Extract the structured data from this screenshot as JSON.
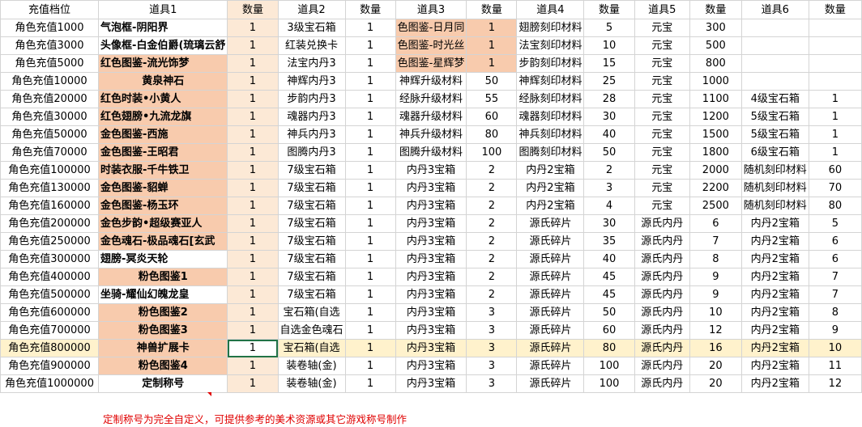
{
  "headers": [
    "充值档位",
    "道具1",
    "数量",
    "道具2",
    "数量",
    "道具3",
    "数量",
    "道具4",
    "数量",
    "道具5",
    "数量",
    "道具6",
    "数量"
  ],
  "rows": [
    [
      "角色充值1000",
      "气泡框-阴阳界",
      "1",
      "3级宝石箱",
      "1",
      "色图鉴-日月同",
      "1",
      "翅膀刻印材料",
      "5",
      "元宝",
      "300",
      "",
      ""
    ],
    [
      "角色充值3000",
      "头像框-白金伯爵(琉璃云舒",
      "1",
      "红装兑换卡",
      "1",
      "色图鉴-时光丝",
      "1",
      "法宝刻印材料",
      "10",
      "元宝",
      "500",
      "",
      ""
    ],
    [
      "角色充值5000",
      "红色图鉴-流光饰梦",
      "1",
      "法宝内丹3",
      "1",
      "色图鉴-星辉梦",
      "1",
      "步韵刻印材料",
      "15",
      "元宝",
      "800",
      "",
      ""
    ],
    [
      "角色充值10000",
      "黄泉神石",
      "1",
      "神辉内丹3",
      "1",
      "神辉升级材料",
      "50",
      "神辉刻印材料",
      "25",
      "元宝",
      "1000",
      "",
      ""
    ],
    [
      "角色充值20000",
      "红色时装•小黄人",
      "1",
      "步韵内丹3",
      "1",
      "经脉升级材料",
      "55",
      "经脉刻印材料",
      "28",
      "元宝",
      "1100",
      "4级宝石箱",
      "1"
    ],
    [
      "角色充值30000",
      "红色翅膀•九流龙旗",
      "1",
      "魂器内丹3",
      "1",
      "魂器升级材料",
      "60",
      "魂器刻印材料",
      "30",
      "元宝",
      "1200",
      "5级宝石箱",
      "1"
    ],
    [
      "角色充值50000",
      "金色图鉴-西施",
      "1",
      "神兵内丹3",
      "1",
      "神兵升级材料",
      "80",
      "神兵刻印材料",
      "40",
      "元宝",
      "1500",
      "5级宝石箱",
      "1"
    ],
    [
      "角色充值70000",
      "金色图鉴-王昭君",
      "1",
      "图腾内丹3",
      "1",
      "图腾升级材料",
      "100",
      "图腾刻印材料",
      "50",
      "元宝",
      "1800",
      "6级宝石箱",
      "1"
    ],
    [
      "角色充值100000",
      "时装衣服-千牛铁卫",
      "1",
      "7级宝石箱",
      "1",
      "内丹3宝箱",
      "2",
      "内丹2宝箱",
      "2",
      "元宝",
      "2000",
      "随机刻印材料",
      "60"
    ],
    [
      "角色充值130000",
      "金色图鉴-貂蝉",
      "1",
      "7级宝石箱",
      "1",
      "内丹3宝箱",
      "2",
      "内丹2宝箱",
      "3",
      "元宝",
      "2200",
      "随机刻印材料",
      "70"
    ],
    [
      "角色充值160000",
      "金色图鉴-杨玉环",
      "1",
      "7级宝石箱",
      "1",
      "内丹3宝箱",
      "2",
      "内丹2宝箱",
      "4",
      "元宝",
      "2500",
      "随机刻印材料",
      "80"
    ],
    [
      "角色充值200000",
      "金色步韵•超级赛亚人",
      "1",
      "7级宝石箱",
      "1",
      "内丹3宝箱",
      "2",
      "源氏碎片",
      "30",
      "源氏内丹",
      "6",
      "内丹2宝箱",
      "5"
    ],
    [
      "角色充值250000",
      "金色魂石-极品魂石[玄武",
      "1",
      "7级宝石箱",
      "1",
      "内丹3宝箱",
      "2",
      "源氏碎片",
      "35",
      "源氏内丹",
      "7",
      "内丹2宝箱",
      "6"
    ],
    [
      "角色充值300000",
      "翅膀-冥炎天轮",
      "1",
      "7级宝石箱",
      "1",
      "内丹3宝箱",
      "2",
      "源氏碎片",
      "40",
      "源氏内丹",
      "8",
      "内丹2宝箱",
      "6"
    ],
    [
      "角色充值400000",
      "粉色图鉴1",
      "1",
      "7级宝石箱",
      "1",
      "内丹3宝箱",
      "2",
      "源氏碎片",
      "45",
      "源氏内丹",
      "9",
      "内丹2宝箱",
      "7"
    ],
    [
      "角色充值500000",
      "坐骑-耀仙幻魄龙皇",
      "1",
      "7级宝石箱",
      "1",
      "内丹3宝箱",
      "2",
      "源氏碎片",
      "45",
      "源氏内丹",
      "9",
      "内丹2宝箱",
      "7"
    ],
    [
      "角色充值600000",
      "粉色图鉴2",
      "1",
      "宝石箱(自选",
      "1",
      "内丹3宝箱",
      "3",
      "源氏碎片",
      "50",
      "源氏内丹",
      "10",
      "内丹2宝箱",
      "8"
    ],
    [
      "角色充值700000",
      "粉色图鉴3",
      "1",
      "自选金色魂石",
      "1",
      "内丹3宝箱",
      "3",
      "源氏碎片",
      "60",
      "源氏内丹",
      "12",
      "内丹2宝箱",
      "9"
    ],
    [
      "角色充值800000",
      "神兽扩展卡",
      "1",
      "宝石箱(自选",
      "1",
      "内丹3宝箱",
      "3",
      "源氏碎片",
      "80",
      "源氏内丹",
      "16",
      "内丹2宝箱",
      "10"
    ],
    [
      "角色充值900000",
      "粉色图鉴4",
      "1",
      "装卷轴(金)",
      "1",
      "内丹3宝箱",
      "3",
      "源氏碎片",
      "100",
      "源氏内丹",
      "20",
      "内丹2宝箱",
      "11"
    ],
    [
      "角色充值1000000",
      "定制称号",
      "1",
      "装卷轴(金)",
      "1",
      "内丹3宝箱",
      "3",
      "源氏碎片",
      "100",
      "源氏内丹",
      "20",
      "内丹2宝箱",
      "12"
    ]
  ],
  "item1_pink_rows": [
    2,
    3,
    4,
    5,
    6,
    7,
    8,
    9,
    10,
    11,
    12,
    14,
    16,
    17,
    18,
    19
  ],
  "item3_pink_rows": [
    0,
    1,
    2
  ],
  "selected_cell": {
    "row": 18,
    "col": 2
  },
  "note": "定制称号为完全自定义，可提供参考的美术资源或其它游戏称号制作",
  "colors": {
    "pink": "#f8cbad",
    "cream": "#fce9d6",
    "grid": "#d4d4d4",
    "selection": "#217346",
    "note_red": "#e00000",
    "row_highlight": "#fff2cc"
  }
}
